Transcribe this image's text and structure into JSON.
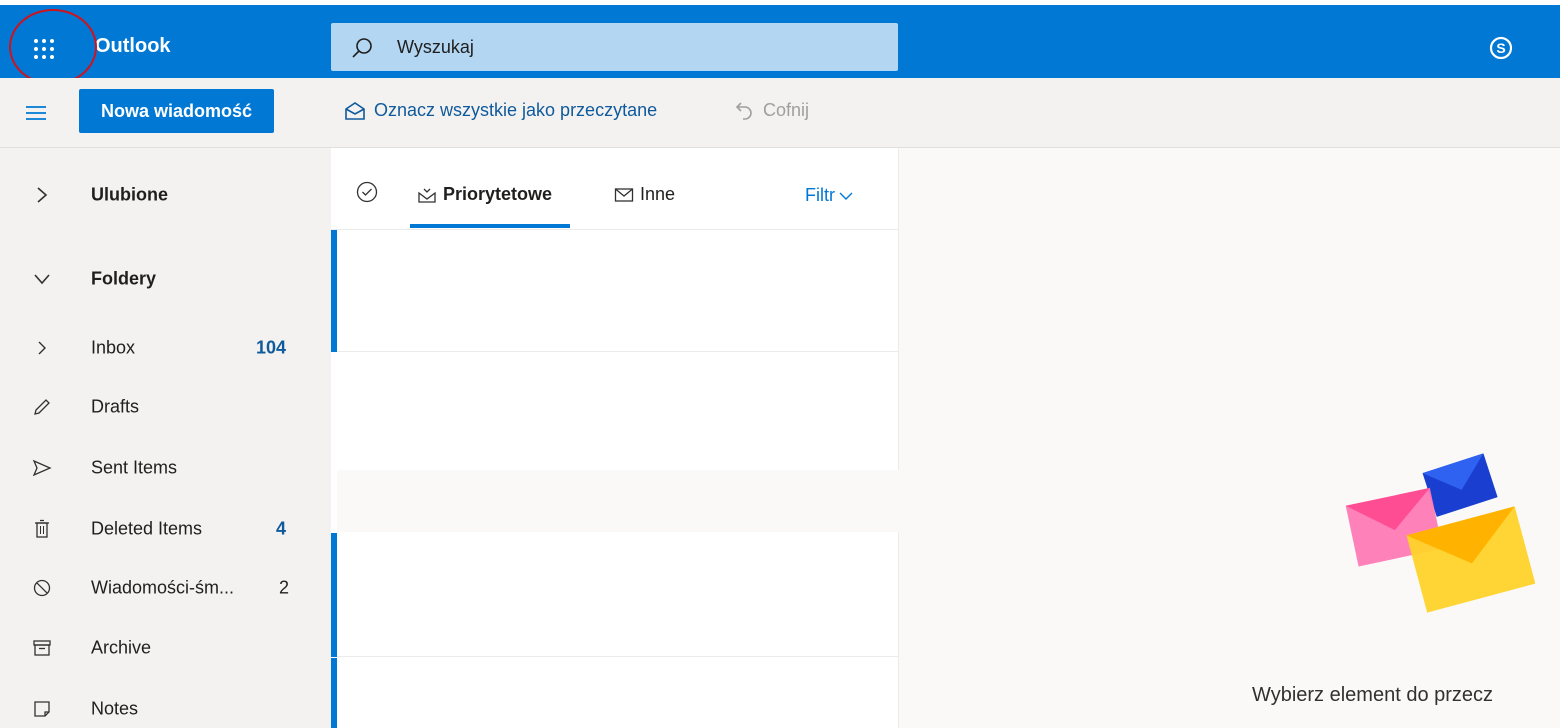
{
  "app": {
    "name": "Outlook"
  },
  "search": {
    "placeholder": "Wyszukaj"
  },
  "toolbar": {
    "new_message_label": "Nowa wiadomość",
    "mark_all_read_label": "Oznacz wszystkie jako przeczytane",
    "undo_label": "Cofnij"
  },
  "sidebar": {
    "sections": [
      {
        "label": "Ulubione",
        "state": "collapsed"
      },
      {
        "label": "Foldery",
        "state": "expanded"
      }
    ],
    "folders": [
      {
        "label": "Inbox",
        "count": "104",
        "icon": "chevron-right-icon"
      },
      {
        "label": "Drafts",
        "count": "",
        "icon": "pencil-icon"
      },
      {
        "label": "Sent Items",
        "count": "",
        "icon": "send-icon"
      },
      {
        "label": "Deleted Items",
        "count": "4",
        "icon": "trash-icon"
      },
      {
        "label": "Wiadomości-śm...",
        "count": "2",
        "icon": "blocked-icon"
      },
      {
        "label": "Archive",
        "count": "",
        "icon": "archive-icon"
      },
      {
        "label": "Notes",
        "count": "",
        "icon": "note-icon"
      }
    ]
  },
  "message_list": {
    "tabs": [
      {
        "label": "Priorytetowe",
        "active": true
      },
      {
        "label": "Inne",
        "active": false
      }
    ],
    "filter_label": "Filtr"
  },
  "reading_pane": {
    "prompt": "Wybierz element do przecz"
  },
  "colors": {
    "brand_blue": "#0078d4",
    "nav_bg": "#f3f2f1",
    "link_blue": "#0f5a9c",
    "annotation_red": "#d0121e"
  }
}
